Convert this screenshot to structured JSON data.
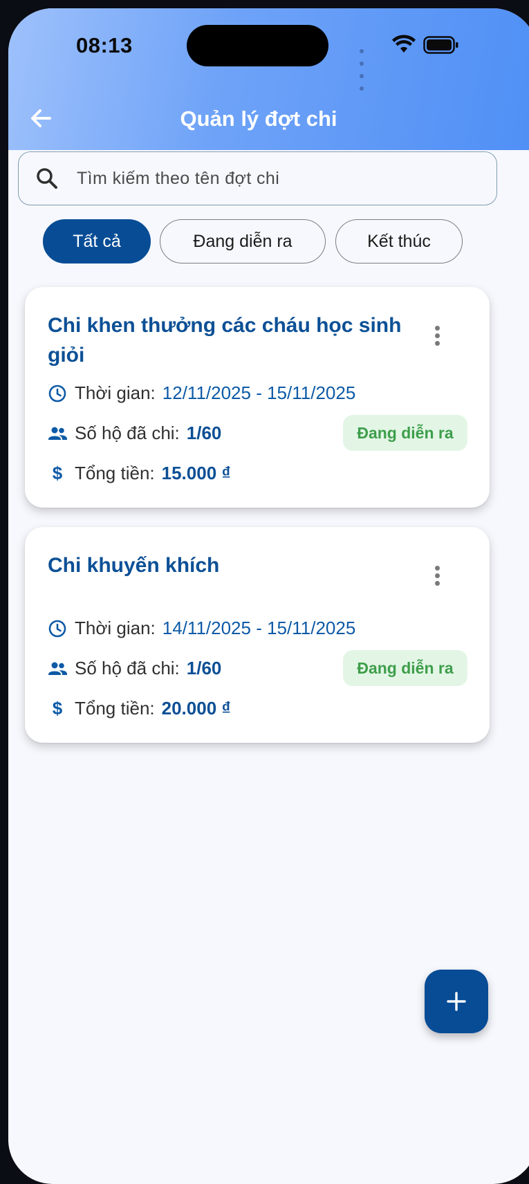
{
  "status_bar": {
    "time": "08:13"
  },
  "header": {
    "title": "Quản lý đợt chi"
  },
  "search": {
    "placeholder": "Tìm kiếm theo tên đợt chi"
  },
  "filters": [
    {
      "label": "Tất cả",
      "active": true
    },
    {
      "label": "Đang diễn ra",
      "active": false
    },
    {
      "label": "Kết thúc",
      "active": false
    }
  ],
  "cards": [
    {
      "title": "Chi khen thưởng các cháu học sinh giỏi",
      "time_label": "Thời gian:",
      "time_value": "12/11/2025 - 15/11/2025",
      "households_label": "Số hộ đã chi:",
      "households_value": "1/60",
      "total_label": "Tổng tiền:",
      "total_value": "15.000 ₫",
      "status": "Đang diễn ra"
    },
    {
      "title": "Chi khuyến khích",
      "time_label": "Thời gian:",
      "time_value": "14/11/2025 - 15/11/2025",
      "households_label": "Số hộ đã chi:",
      "households_value": "1/60",
      "total_label": "Tổng tiền:",
      "total_value": "20.000 ₫",
      "status": "Đang diễn ra"
    }
  ],
  "colors": {
    "primary": "#074c95",
    "title_blue": "#0c5096",
    "badge_bg": "#e3f6e6",
    "badge_text": "#3e9e4b",
    "header_gradient_start": "#9ec1fb",
    "header_gradient_end": "#4f8ff5"
  },
  "icons": {
    "back": "arrow-left-icon",
    "search": "search-icon",
    "time": "clock-icon",
    "households": "people-icon",
    "total": "dollar-icon",
    "menu": "more-vertical-icon",
    "add": "plus-icon"
  }
}
